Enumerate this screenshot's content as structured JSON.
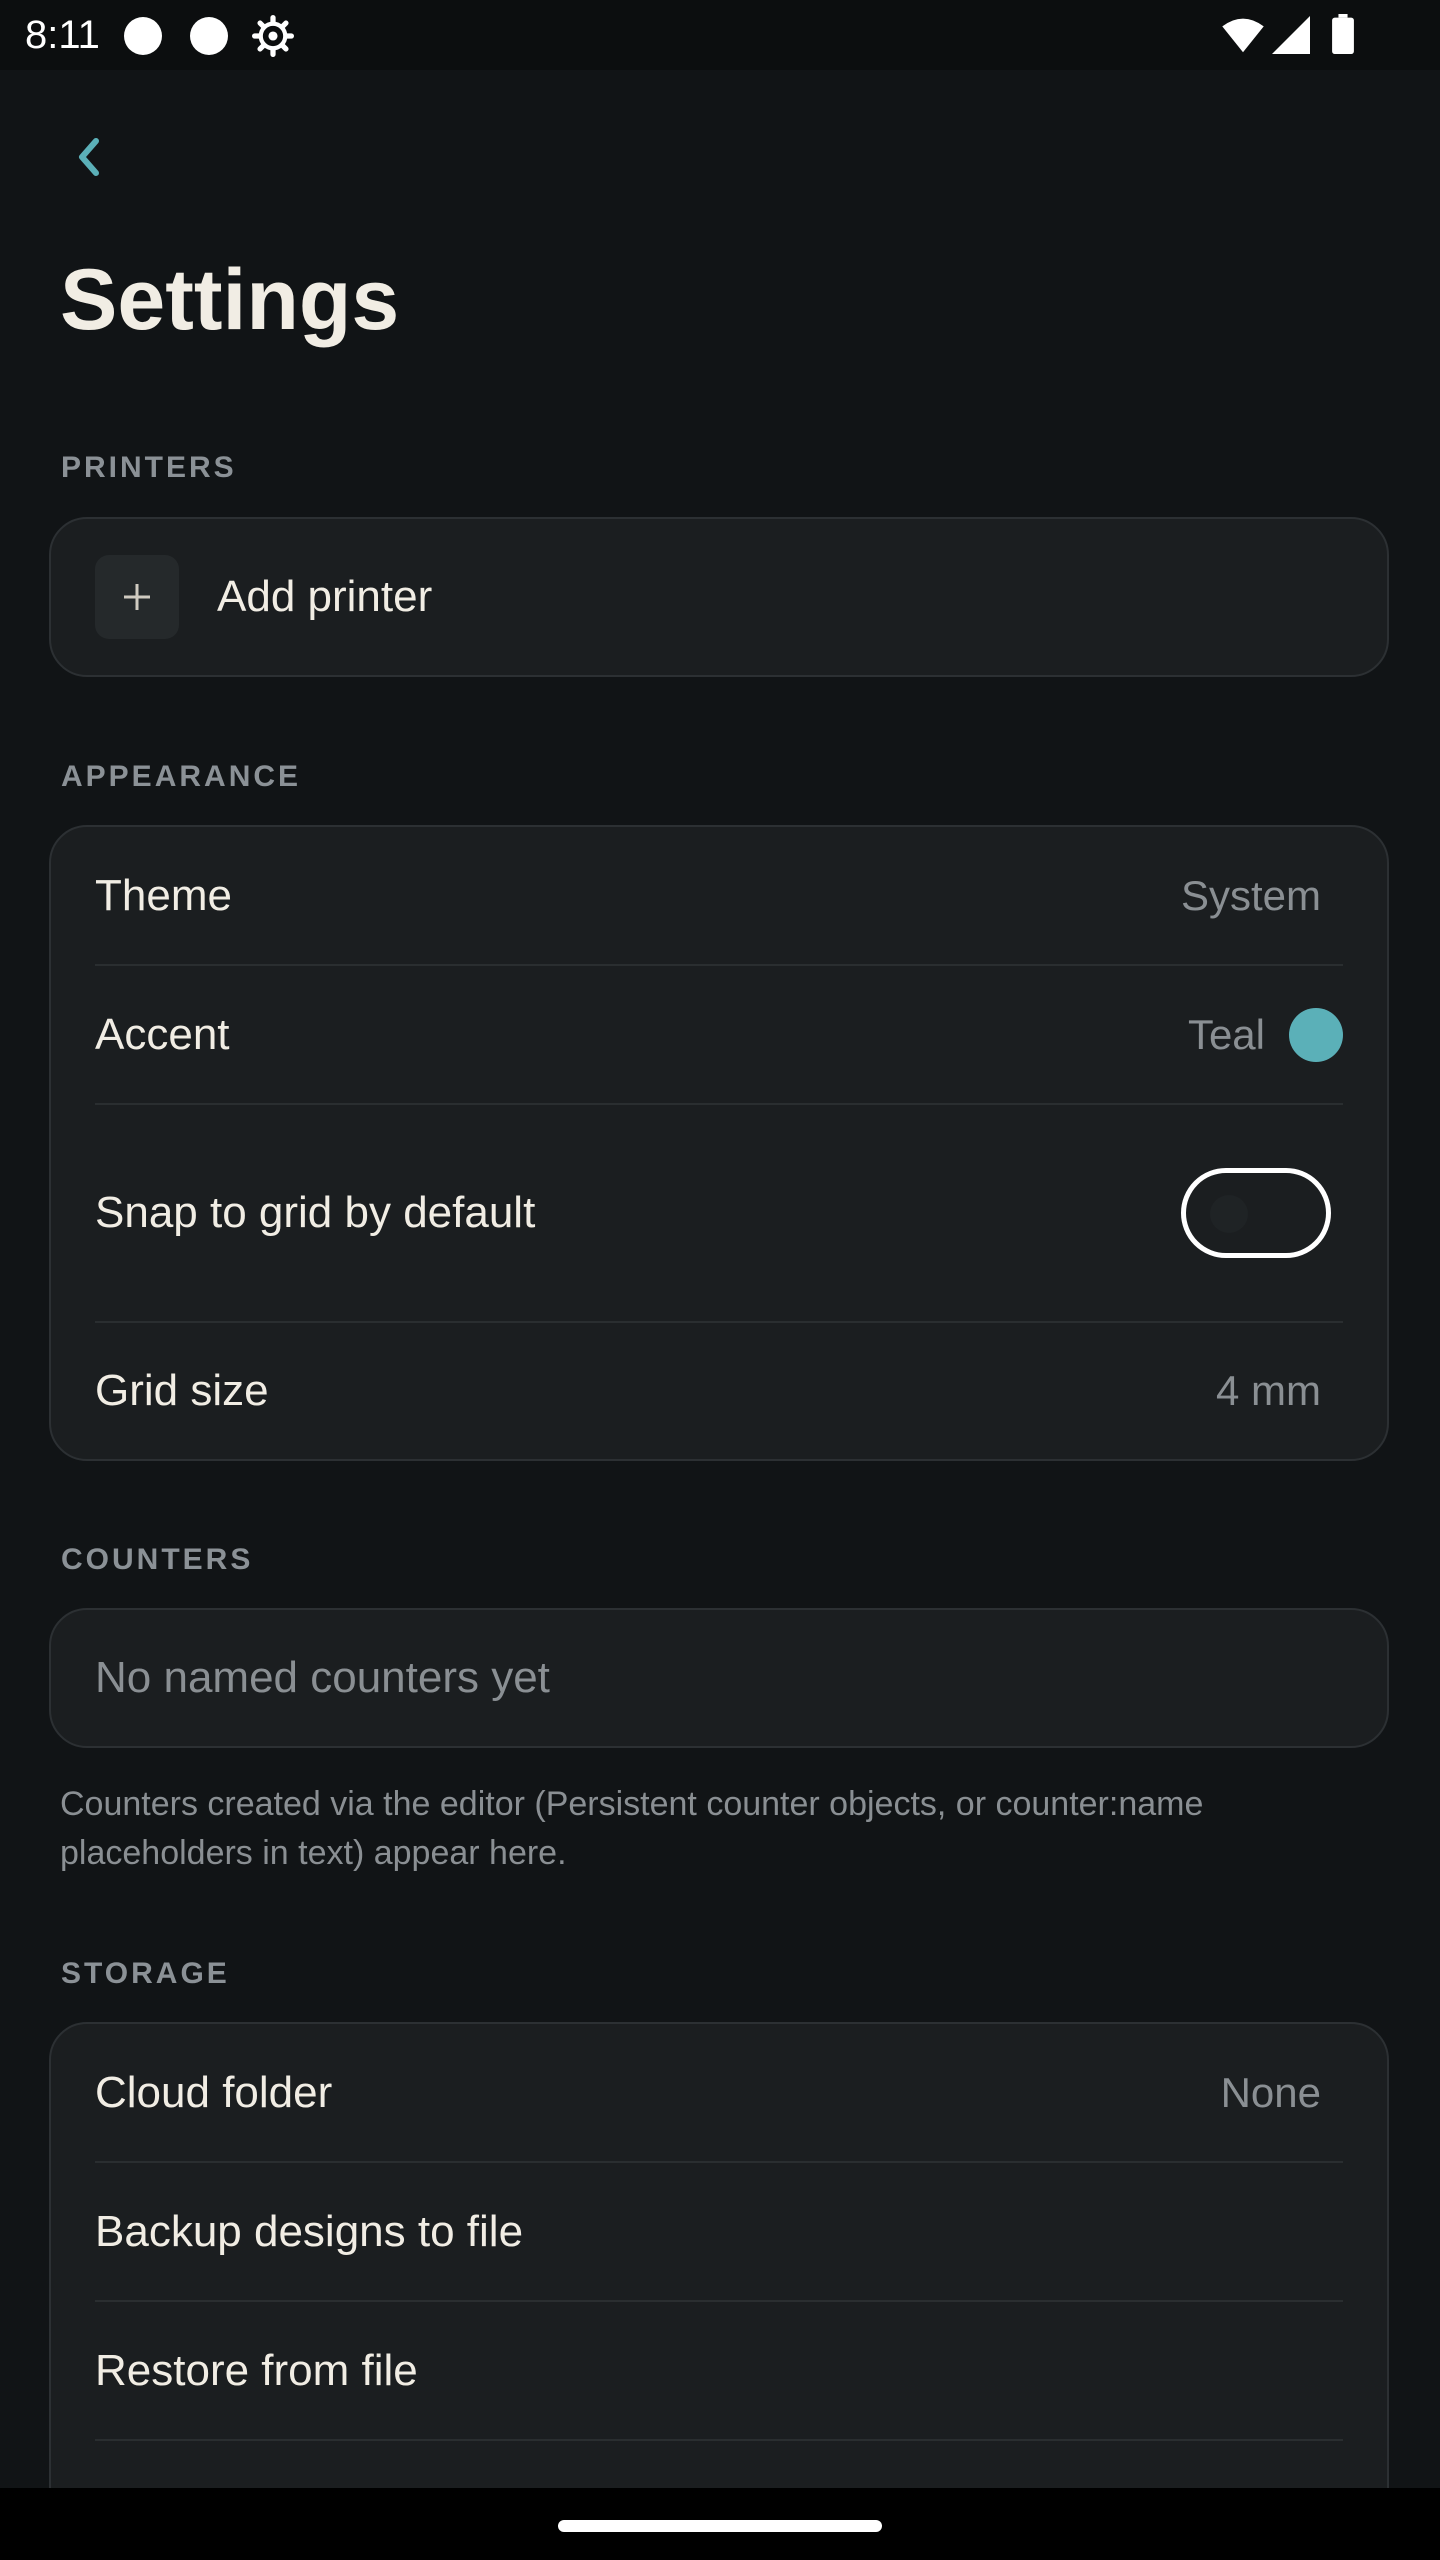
{
  "status_bar": {
    "time": "8:11",
    "icons": [
      "notification-dot-icon",
      "notification-dot-icon",
      "settings-gear-icon",
      "wifi-icon",
      "signal-icon",
      "battery-icon"
    ]
  },
  "header": {
    "back_icon": "chevron-left-icon",
    "title": "Settings"
  },
  "sections": {
    "printers": {
      "label": "PRINTERS",
      "add_label": "Add printer",
      "add_icon": "plus-icon"
    },
    "appearance": {
      "label": "APPEARANCE",
      "theme_label": "Theme",
      "theme_value": "System",
      "accent_label": "Accent",
      "accent_value": "Teal",
      "accent_color": "#5bb0b8",
      "snap_label": "Snap to grid by default",
      "snap_enabled": false,
      "grid_label": "Grid size",
      "grid_value": "4 mm"
    },
    "counters": {
      "label": "COUNTERS",
      "empty_text": "No named counters yet",
      "note": "Counters created via the editor (Persistent counter objects, or counter:name placeholders in text) appear here."
    },
    "storage": {
      "label": "STORAGE",
      "cloud_label": "Cloud folder",
      "cloud_value": "None",
      "backup_label": "Backup designs to file",
      "restore_label": "Restore from file"
    }
  },
  "colors": {
    "background": "#111416",
    "card": "#1b1e20",
    "accent": "#5bb0b8",
    "text_primary": "#f1ede4",
    "text_secondary": "#8a8f93"
  }
}
